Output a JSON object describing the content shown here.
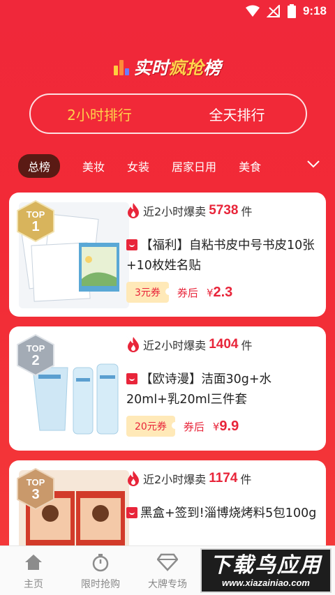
{
  "status_bar": {
    "time": "9:18"
  },
  "header": {
    "title_part1": "实时",
    "title_part2": "疯抢",
    "title_part3": "榜"
  },
  "time_tabs": [
    {
      "label": "2小时排行",
      "active": true
    },
    {
      "label": "全天排行",
      "active": false
    }
  ],
  "categories": [
    {
      "label": "总榜",
      "active": true
    },
    {
      "label": "美妆"
    },
    {
      "label": "女装"
    },
    {
      "label": "居家日用"
    },
    {
      "label": "美食"
    }
  ],
  "cards": [
    {
      "rank_label": "TOP",
      "rank": "1",
      "sales_prefix": "近2小时爆卖",
      "sales_count": "5738",
      "sales_unit": "件",
      "title": "【福利】自粘书皮中号书皮10张+10枚姓名贴",
      "coupon": "3元券",
      "after_label": "券后",
      "currency": "¥",
      "price": "2.3"
    },
    {
      "rank_label": "TOP",
      "rank": "2",
      "sales_prefix": "近2小时爆卖",
      "sales_count": "1404",
      "sales_unit": "件",
      "title": "【欧诗漫】洁面30g+水20ml+乳20ml三件套",
      "coupon": "20元券",
      "after_label": "券后",
      "currency": "¥",
      "price": "9.9"
    },
    {
      "rank_label": "TOP",
      "rank": "3",
      "sales_prefix": "近2小时爆卖",
      "sales_count": "1174",
      "sales_unit": "件",
      "title": "黑盒+签到!淄博烧烤料5包100g",
      "coupon": "",
      "after_label": "",
      "currency": "",
      "price": ""
    }
  ],
  "bottom_nav": [
    {
      "label": "主页",
      "icon": "home-icon"
    },
    {
      "label": "限时抢购",
      "icon": "stopwatch-icon"
    },
    {
      "label": "大牌专场",
      "icon": "diamond-icon"
    }
  ],
  "watermark": {
    "main": "下载鸟应用",
    "sub": "www.xiazainiao.com"
  },
  "colors": {
    "primary_red": "#f0283a",
    "badge_gold": "#c9a54a",
    "badge_silver": "#9aa3ad",
    "badge_bronze": "#c79a6e",
    "coupon_bg": "#ffe9b8"
  }
}
